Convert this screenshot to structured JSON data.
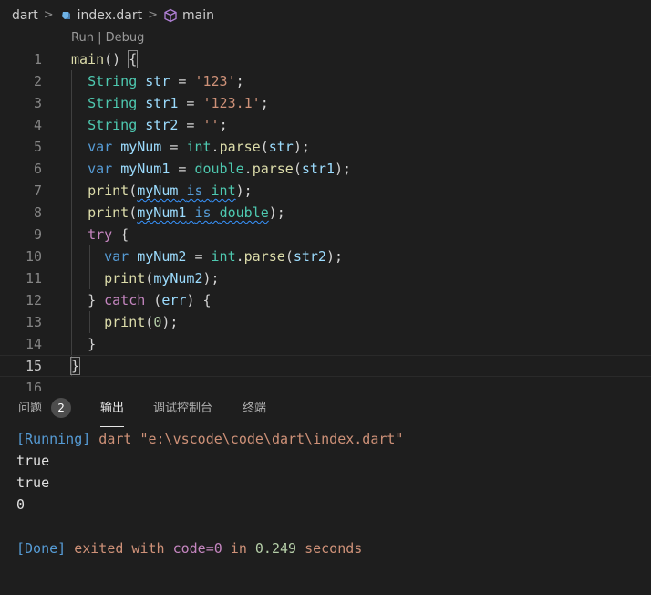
{
  "breadcrumb": {
    "folder": "dart",
    "file": "index.dart",
    "symbol": "main"
  },
  "codelens": {
    "run": "Run",
    "separator": "|",
    "debug": "Debug"
  },
  "editor": {
    "line_numbers": [
      "1",
      "2",
      "3",
      "4",
      "5",
      "6",
      "7",
      "8",
      "9",
      "10",
      "11",
      "12",
      "13",
      "14",
      "15",
      "16"
    ],
    "lines": [
      [
        {
          "t": "fn",
          "v": "main"
        },
        {
          "t": "brk",
          "v": "() "
        },
        {
          "t": "brk",
          "v": "{"
        }
      ],
      [
        {
          "t": "pad",
          "v": "  "
        },
        {
          "t": "type",
          "v": "String"
        },
        {
          "t": "plain",
          "v": " "
        },
        {
          "t": "var",
          "v": "str"
        },
        {
          "t": "plain",
          "v": " = "
        },
        {
          "t": "str",
          "v": "'123'"
        },
        {
          "t": "plain",
          "v": ";"
        }
      ],
      [
        {
          "t": "pad",
          "v": "  "
        },
        {
          "t": "type",
          "v": "String"
        },
        {
          "t": "plain",
          "v": " "
        },
        {
          "t": "var",
          "v": "str1"
        },
        {
          "t": "plain",
          "v": " = "
        },
        {
          "t": "str",
          "v": "'123.1'"
        },
        {
          "t": "plain",
          "v": ";"
        }
      ],
      [
        {
          "t": "pad",
          "v": "  "
        },
        {
          "t": "type",
          "v": "String"
        },
        {
          "t": "plain",
          "v": " "
        },
        {
          "t": "var",
          "v": "str2"
        },
        {
          "t": "plain",
          "v": " = "
        },
        {
          "t": "str",
          "v": "''"
        },
        {
          "t": "plain",
          "v": ";"
        }
      ],
      [
        {
          "t": "pad",
          "v": "  "
        },
        {
          "t": "kw",
          "v": "var"
        },
        {
          "t": "plain",
          "v": " "
        },
        {
          "t": "var",
          "v": "myNum"
        },
        {
          "t": "plain",
          "v": " = "
        },
        {
          "t": "type",
          "v": "int"
        },
        {
          "t": "plain",
          "v": "."
        },
        {
          "t": "fn",
          "v": "parse"
        },
        {
          "t": "plain",
          "v": "("
        },
        {
          "t": "var",
          "v": "str"
        },
        {
          "t": "plain",
          "v": ");"
        }
      ],
      [
        {
          "t": "pad",
          "v": "  "
        },
        {
          "t": "kw",
          "v": "var"
        },
        {
          "t": "plain",
          "v": " "
        },
        {
          "t": "var",
          "v": "myNum1"
        },
        {
          "t": "plain",
          "v": " = "
        },
        {
          "t": "type",
          "v": "double"
        },
        {
          "t": "plain",
          "v": "."
        },
        {
          "t": "fn",
          "v": "parse"
        },
        {
          "t": "plain",
          "v": "("
        },
        {
          "t": "var",
          "v": "str1"
        },
        {
          "t": "plain",
          "v": ");"
        }
      ],
      [
        {
          "t": "pad",
          "v": "  "
        },
        {
          "t": "fn",
          "v": "print"
        },
        {
          "t": "plain",
          "v": "("
        },
        {
          "t": "var",
          "v": "myNum",
          "squig": true
        },
        {
          "t": "plain",
          "v": " ",
          "squig": true
        },
        {
          "t": "kw",
          "v": "is",
          "squig": true
        },
        {
          "t": "plain",
          "v": " ",
          "squig": true
        },
        {
          "t": "type",
          "v": "int",
          "squig": true
        },
        {
          "t": "plain",
          "v": ");"
        }
      ],
      [
        {
          "t": "pad",
          "v": "  "
        },
        {
          "t": "fn",
          "v": "print"
        },
        {
          "t": "plain",
          "v": "("
        },
        {
          "t": "var",
          "v": "myNum1",
          "squig": true
        },
        {
          "t": "plain",
          "v": " ",
          "squig": true
        },
        {
          "t": "kw",
          "v": "is",
          "squig": true
        },
        {
          "t": "plain",
          "v": " ",
          "squig": true
        },
        {
          "t": "type",
          "v": "double",
          "squig": true
        },
        {
          "t": "plain",
          "v": ");"
        }
      ],
      [
        {
          "t": "pad",
          "v": "  "
        },
        {
          "t": "ctl",
          "v": "try"
        },
        {
          "t": "plain",
          "v": " {"
        }
      ],
      [
        {
          "t": "pad",
          "v": "    "
        },
        {
          "t": "kw",
          "v": "var"
        },
        {
          "t": "plain",
          "v": " "
        },
        {
          "t": "var",
          "v": "myNum2"
        },
        {
          "t": "plain",
          "v": " = "
        },
        {
          "t": "type",
          "v": "int"
        },
        {
          "t": "plain",
          "v": "."
        },
        {
          "t": "fn",
          "v": "parse"
        },
        {
          "t": "plain",
          "v": "("
        },
        {
          "t": "var",
          "v": "str2"
        },
        {
          "t": "plain",
          "v": ");"
        }
      ],
      [
        {
          "t": "pad",
          "v": "    "
        },
        {
          "t": "fn",
          "v": "print"
        },
        {
          "t": "plain",
          "v": "("
        },
        {
          "t": "var",
          "v": "myNum2"
        },
        {
          "t": "plain",
          "v": ");"
        }
      ],
      [
        {
          "t": "pad",
          "v": "  "
        },
        {
          "t": "plain",
          "v": "} "
        },
        {
          "t": "ctl",
          "v": "catch"
        },
        {
          "t": "plain",
          "v": " ("
        },
        {
          "t": "var",
          "v": "err"
        },
        {
          "t": "plain",
          "v": ") {"
        }
      ],
      [
        {
          "t": "pad",
          "v": "    "
        },
        {
          "t": "fn",
          "v": "print"
        },
        {
          "t": "plain",
          "v": "("
        },
        {
          "t": "num",
          "v": "0"
        },
        {
          "t": "plain",
          "v": ");"
        }
      ],
      [
        {
          "t": "pad",
          "v": "  "
        },
        {
          "t": "plain",
          "v": "}"
        }
      ],
      [
        {
          "t": "brk",
          "v": "}"
        }
      ],
      []
    ]
  },
  "panel": {
    "tabs": [
      {
        "label": "问题",
        "badge": "2"
      },
      {
        "label": "输出"
      },
      {
        "label": "调试控制台"
      },
      {
        "label": "终端"
      }
    ],
    "active_tab": "输出",
    "output": {
      "running_tag": "[Running]",
      "command": " dart \"e:\\vscode\\code\\dart\\index.dart\"",
      "results": [
        "true",
        "true",
        "0"
      ],
      "done_tag": "[Done]",
      "done_text1": " exited with ",
      "done_code": "code=0",
      "done_text2": " in ",
      "done_secs": "0.249",
      "done_text3": " seconds"
    }
  }
}
